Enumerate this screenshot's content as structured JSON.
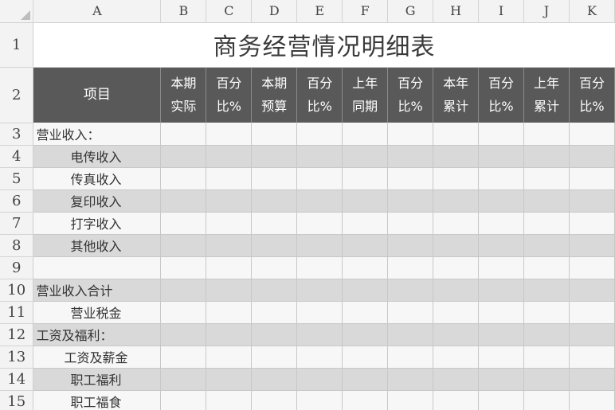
{
  "columns": [
    "A",
    "B",
    "C",
    "D",
    "E",
    "F",
    "G",
    "H",
    "I",
    "J",
    "K"
  ],
  "title": "商务经营情况明细表",
  "header": {
    "item": "项目",
    "cols": [
      [
        "本期",
        "实际"
      ],
      [
        "百分",
        "比%"
      ],
      [
        "本期",
        "预算"
      ],
      [
        "百分",
        "比%"
      ],
      [
        "上年",
        "同期"
      ],
      [
        "百分",
        "比%"
      ],
      [
        "本年",
        "累计"
      ],
      [
        "百分",
        "比%"
      ],
      [
        "上年",
        "累计"
      ],
      [
        "百分",
        "比%"
      ]
    ]
  },
  "row_numbers": [
    "1",
    "2",
    "3",
    "4",
    "5",
    "6",
    "7",
    "8",
    "9",
    "10",
    "11",
    "12",
    "13",
    "14",
    "15"
  ],
  "rows": [
    {
      "label": "营业收入：",
      "indent": "main"
    },
    {
      "label": "电传收入",
      "indent": "sub"
    },
    {
      "label": "传真收入",
      "indent": "sub"
    },
    {
      "label": "复印收入",
      "indent": "sub"
    },
    {
      "label": "打字收入",
      "indent": "sub"
    },
    {
      "label": "其他收入",
      "indent": "sub"
    },
    {
      "label": "",
      "indent": "main"
    },
    {
      "label": "营业收入合计",
      "indent": "main"
    },
    {
      "label": "营业税金",
      "indent": "sub"
    },
    {
      "label": "工资及福利：",
      "indent": "main"
    },
    {
      "label": "工资及薪金",
      "indent": "sub2"
    },
    {
      "label": "职工福利",
      "indent": "sub"
    },
    {
      "label": "职工福食",
      "indent": "sub"
    }
  ],
  "colors": {
    "header_bg": "#595959",
    "band_dark": "#d9d9d9",
    "band_light": "#f7f7f7"
  }
}
